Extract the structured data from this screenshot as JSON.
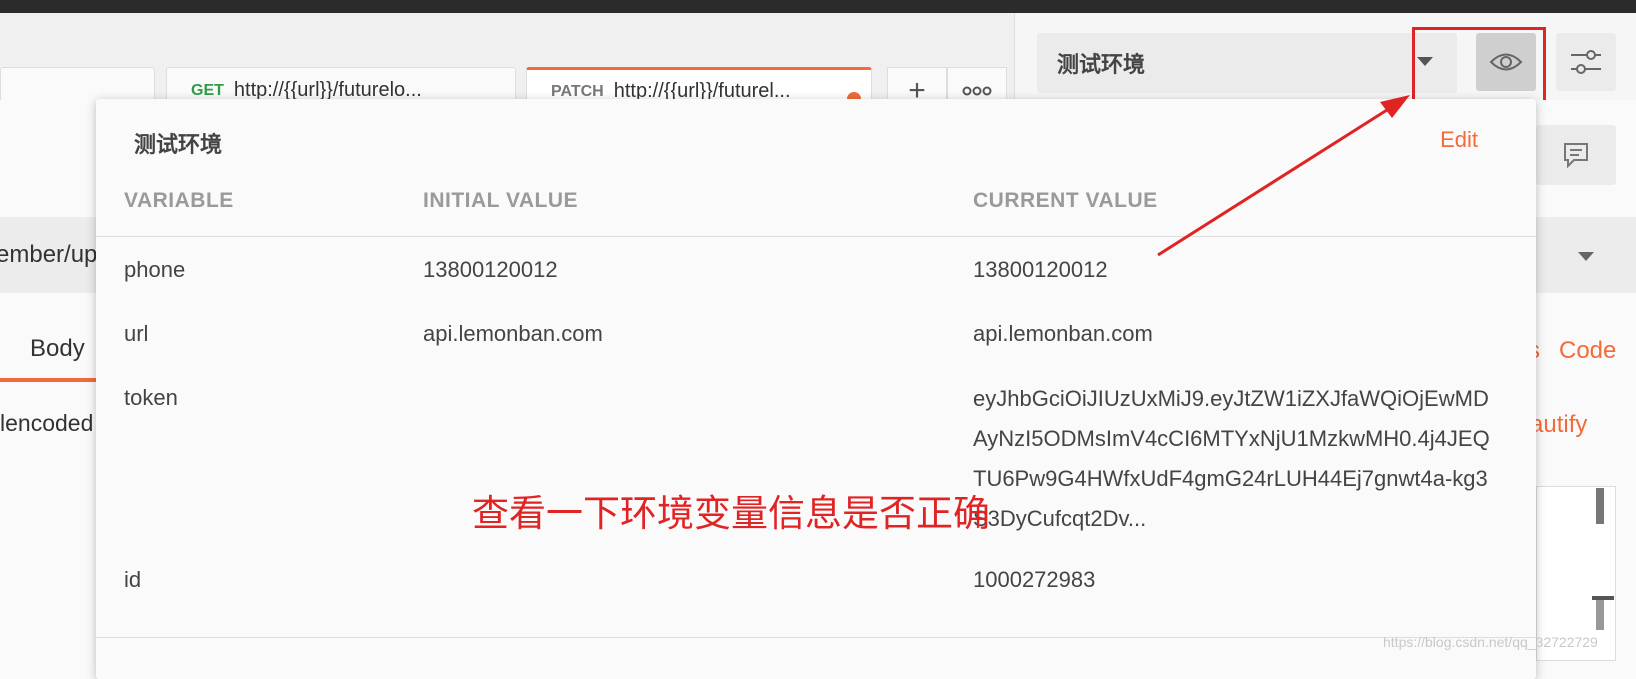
{
  "tabs": [
    {
      "method": "",
      "url": ""
    },
    {
      "method": "GET",
      "url": "http://{{url}}/futurelo...",
      "method_color": "#2e9d45"
    },
    {
      "method": "PATCH",
      "url": "http://{{url}}/futurel...",
      "method_color": "#777777",
      "active": true,
      "unsaved": true
    }
  ],
  "tab_buttons": {
    "new_tab_icon": "plus-icon",
    "more_icon": "ellipsis-icon"
  },
  "environment": {
    "selected": "测试环境",
    "eye_icon": "eye-icon",
    "settings_icon": "sliders-icon"
  },
  "background": {
    "url_fragment": "ember/up",
    "body_tab": "Body",
    "encoded_fragment": "lencoded",
    "code_link": "Code",
    "beautify_link": "autify",
    "s_fragment": "s",
    "comment_icon": "comment-icon"
  },
  "popover": {
    "title": "测试环境",
    "edit_label": "Edit",
    "columns": {
      "variable": "VARIABLE",
      "initial": "INITIAL VALUE",
      "current": "CURRENT VALUE"
    },
    "rows": [
      {
        "variable": "phone",
        "initial": "13800120012",
        "current": "13800120012"
      },
      {
        "variable": "url",
        "initial": "api.lemonban.com",
        "current": "api.lemonban.com"
      },
      {
        "variable": "token",
        "initial": "",
        "current": "eyJhbGciOiJIUzUxMiJ9.eyJtZW1iZXJfaWQiOjEwMDAyNzI5ODMsImV4cCI6MTYxNjU1MzkwMH0.4j4JEQTU6Pw9G4HWfxUdF4gmG24rLUH44Ej7gnwt4a-kg3S3DyCufcqt2Dv..."
      },
      {
        "variable": "id",
        "initial": "",
        "current": "1000272983"
      }
    ]
  },
  "annotation": "查看一下环境变量信息是否正确",
  "watermark": "https://blog.csdn.net/qq_32722729",
  "colors": {
    "accent": "#f26b3a",
    "annotation_red": "#e02424"
  }
}
